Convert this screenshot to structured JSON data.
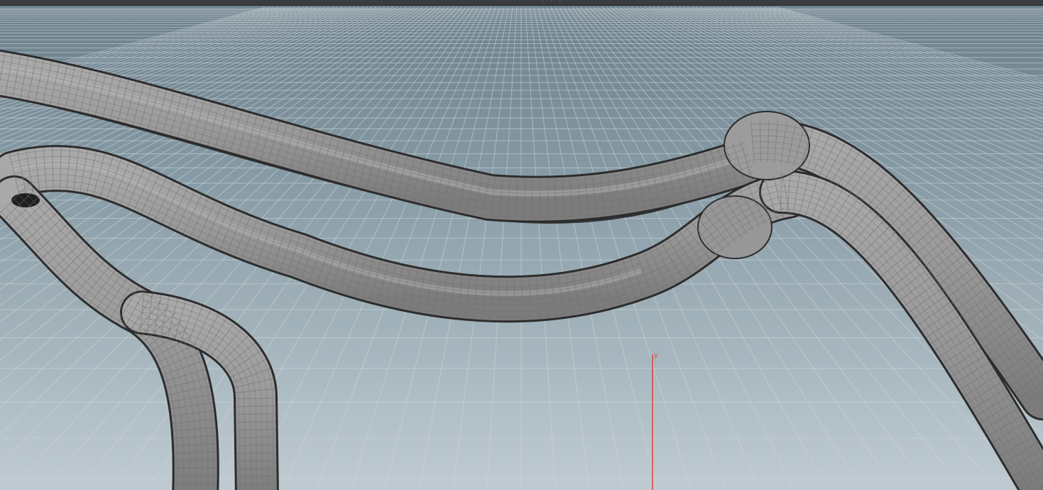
{
  "viewport": {
    "axis_label": "y"
  },
  "colors": {
    "sky_top": "#6c7f8b",
    "floor_bottom": "#bdc9cf",
    "grid": "#c9d3d8",
    "tube_fill": "#959595",
    "tube_edge": "#2a2a2a",
    "wire": "#6f6f6f",
    "axis": "#e04040"
  }
}
